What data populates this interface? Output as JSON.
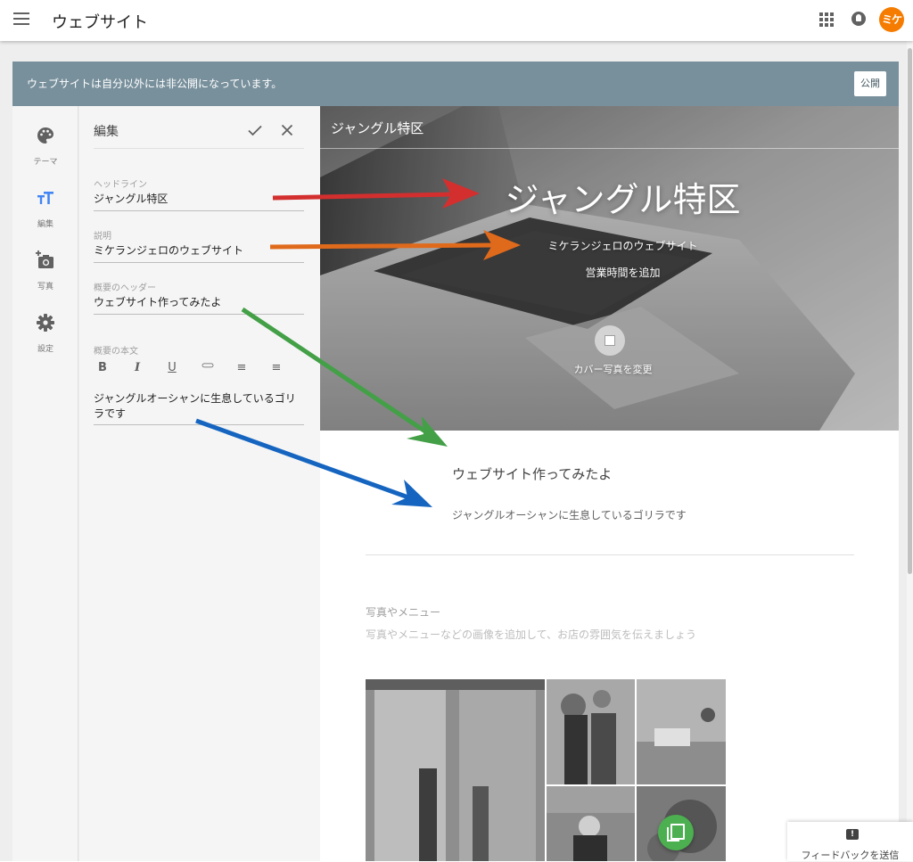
{
  "app": {
    "title": "ウェブサイト",
    "avatar_text": "ミケ"
  },
  "banner": {
    "text": "ウェブサイトは自分以外には非公開になっています。",
    "publish_label": "公開"
  },
  "rail": {
    "items": [
      {
        "label": "テーマ",
        "icon": "palette-icon",
        "active": false
      },
      {
        "label": "編集",
        "icon": "text-format-icon",
        "active": true
      },
      {
        "label": "写真",
        "icon": "add-photo-icon",
        "active": false
      },
      {
        "label": "設定",
        "icon": "gear-icon",
        "active": false
      }
    ]
  },
  "panel": {
    "title": "編集",
    "fields": [
      {
        "label": "ヘッドライン",
        "value": "ジャングル特区"
      },
      {
        "label": "説明",
        "value": "ミケランジェロのウェブサイト"
      },
      {
        "label": "概要のヘッダー",
        "value": "ウェブサイト作ってみたよ"
      }
    ],
    "body_label": "概要の本文",
    "body_toolbar": [
      {
        "label": "B",
        "icon": "bold-icon"
      },
      {
        "label": "I",
        "icon": "italic-icon"
      },
      {
        "label": "U",
        "icon": "underline-icon"
      },
      {
        "label": "⊂⊃",
        "icon": "link-icon"
      },
      {
        "label": "≡",
        "icon": "numbered-list-icon"
      },
      {
        "label": "≡",
        "icon": "bulleted-list-icon"
      }
    ],
    "body_value": "ジャングルオーシャンに生息しているゴリラです"
  },
  "preview": {
    "nav_title": "ジャングル特区",
    "headline": "ジャングル特区",
    "description": "ミケランジェロのウェブサイト",
    "hours": "営業時間を追加",
    "cover_label": "カバー写真を変更",
    "about_title": "ウェブサイト作ってみたよ",
    "about_body": "ジャングルオーシャンに生息しているゴリラです",
    "photos_title": "写真やメニュー",
    "photos_desc": "写真やメニューなどの画像を追加して、お店の雰囲気を伝えましょう"
  },
  "feedback": {
    "label": "フィードバックを送信"
  },
  "colors": {
    "banner": "#78909c",
    "avatar": "#f57c00",
    "active_rail": "#4285f4",
    "fab": "#4caf50",
    "arrow_red": "#d32f2f",
    "arrow_orange": "#e06a1c",
    "arrow_green": "#43a047",
    "arrow_blue": "#1565c0"
  }
}
